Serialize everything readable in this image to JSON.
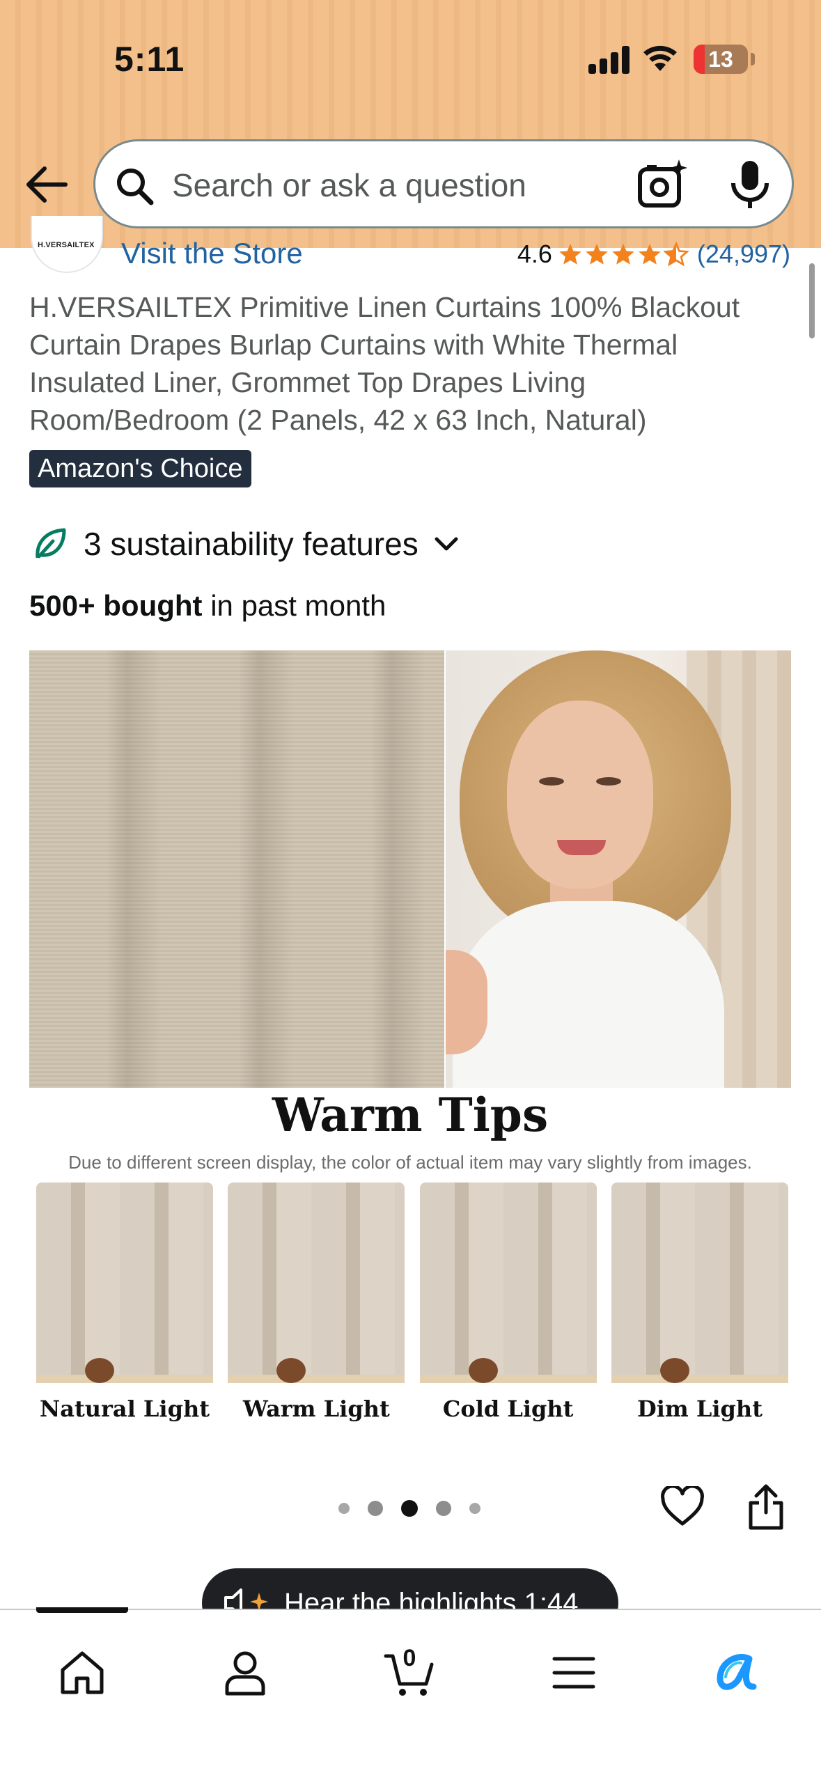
{
  "status_bar": {
    "time": "5:11",
    "battery_level": "13",
    "icons": [
      "cellular-signal-icon",
      "wifi-icon",
      "battery-icon"
    ]
  },
  "search": {
    "placeholder": "Search or ask a question",
    "icons": [
      "back-arrow-icon",
      "search-icon",
      "camera-icon",
      "microphone-icon"
    ]
  },
  "store": {
    "brand_logo_text": "H.VERSAILTEX",
    "visit_label": "Visit the Store",
    "rating": "4.6",
    "stars_fraction": 0.92,
    "review_count": "(24,997)",
    "star_color": "#f3811c"
  },
  "product": {
    "title": "H.VERSAILTEX Primitive Linen Curtains 100% Blackout Curtain Drapes Burlap Curtains with White Thermal Insulated Liner, Grommet Top Drapes Living Room/Bedroom (2 Panels, 42 x 63 Inch, Natural)",
    "badge": "Amazon's Choice",
    "sustainability": "3 sustainability features",
    "bought_bold": "500+ bought",
    "bought_rest": " in past month"
  },
  "image": {
    "heading": "Warm Tips",
    "subheading": "Due to different screen display, the color of actual item may vary slightly from images.",
    "swatches": [
      "Natural Light",
      "Warm Light",
      "Cold Light",
      "Dim Light"
    ]
  },
  "carousel": {
    "total_dots": 5,
    "active_index": 2
  },
  "audio": {
    "label": "Hear the highlights 1:44"
  },
  "bottom_nav": {
    "items": [
      "home",
      "account",
      "cart",
      "menu",
      "rufus"
    ],
    "cart_count": "0"
  },
  "colors": {
    "header_bg": "#f3c08c",
    "link": "#2162a1",
    "badge_bg": "#232f3e",
    "leaf": "#067d62",
    "rufus_accent": "#1a98ff"
  }
}
